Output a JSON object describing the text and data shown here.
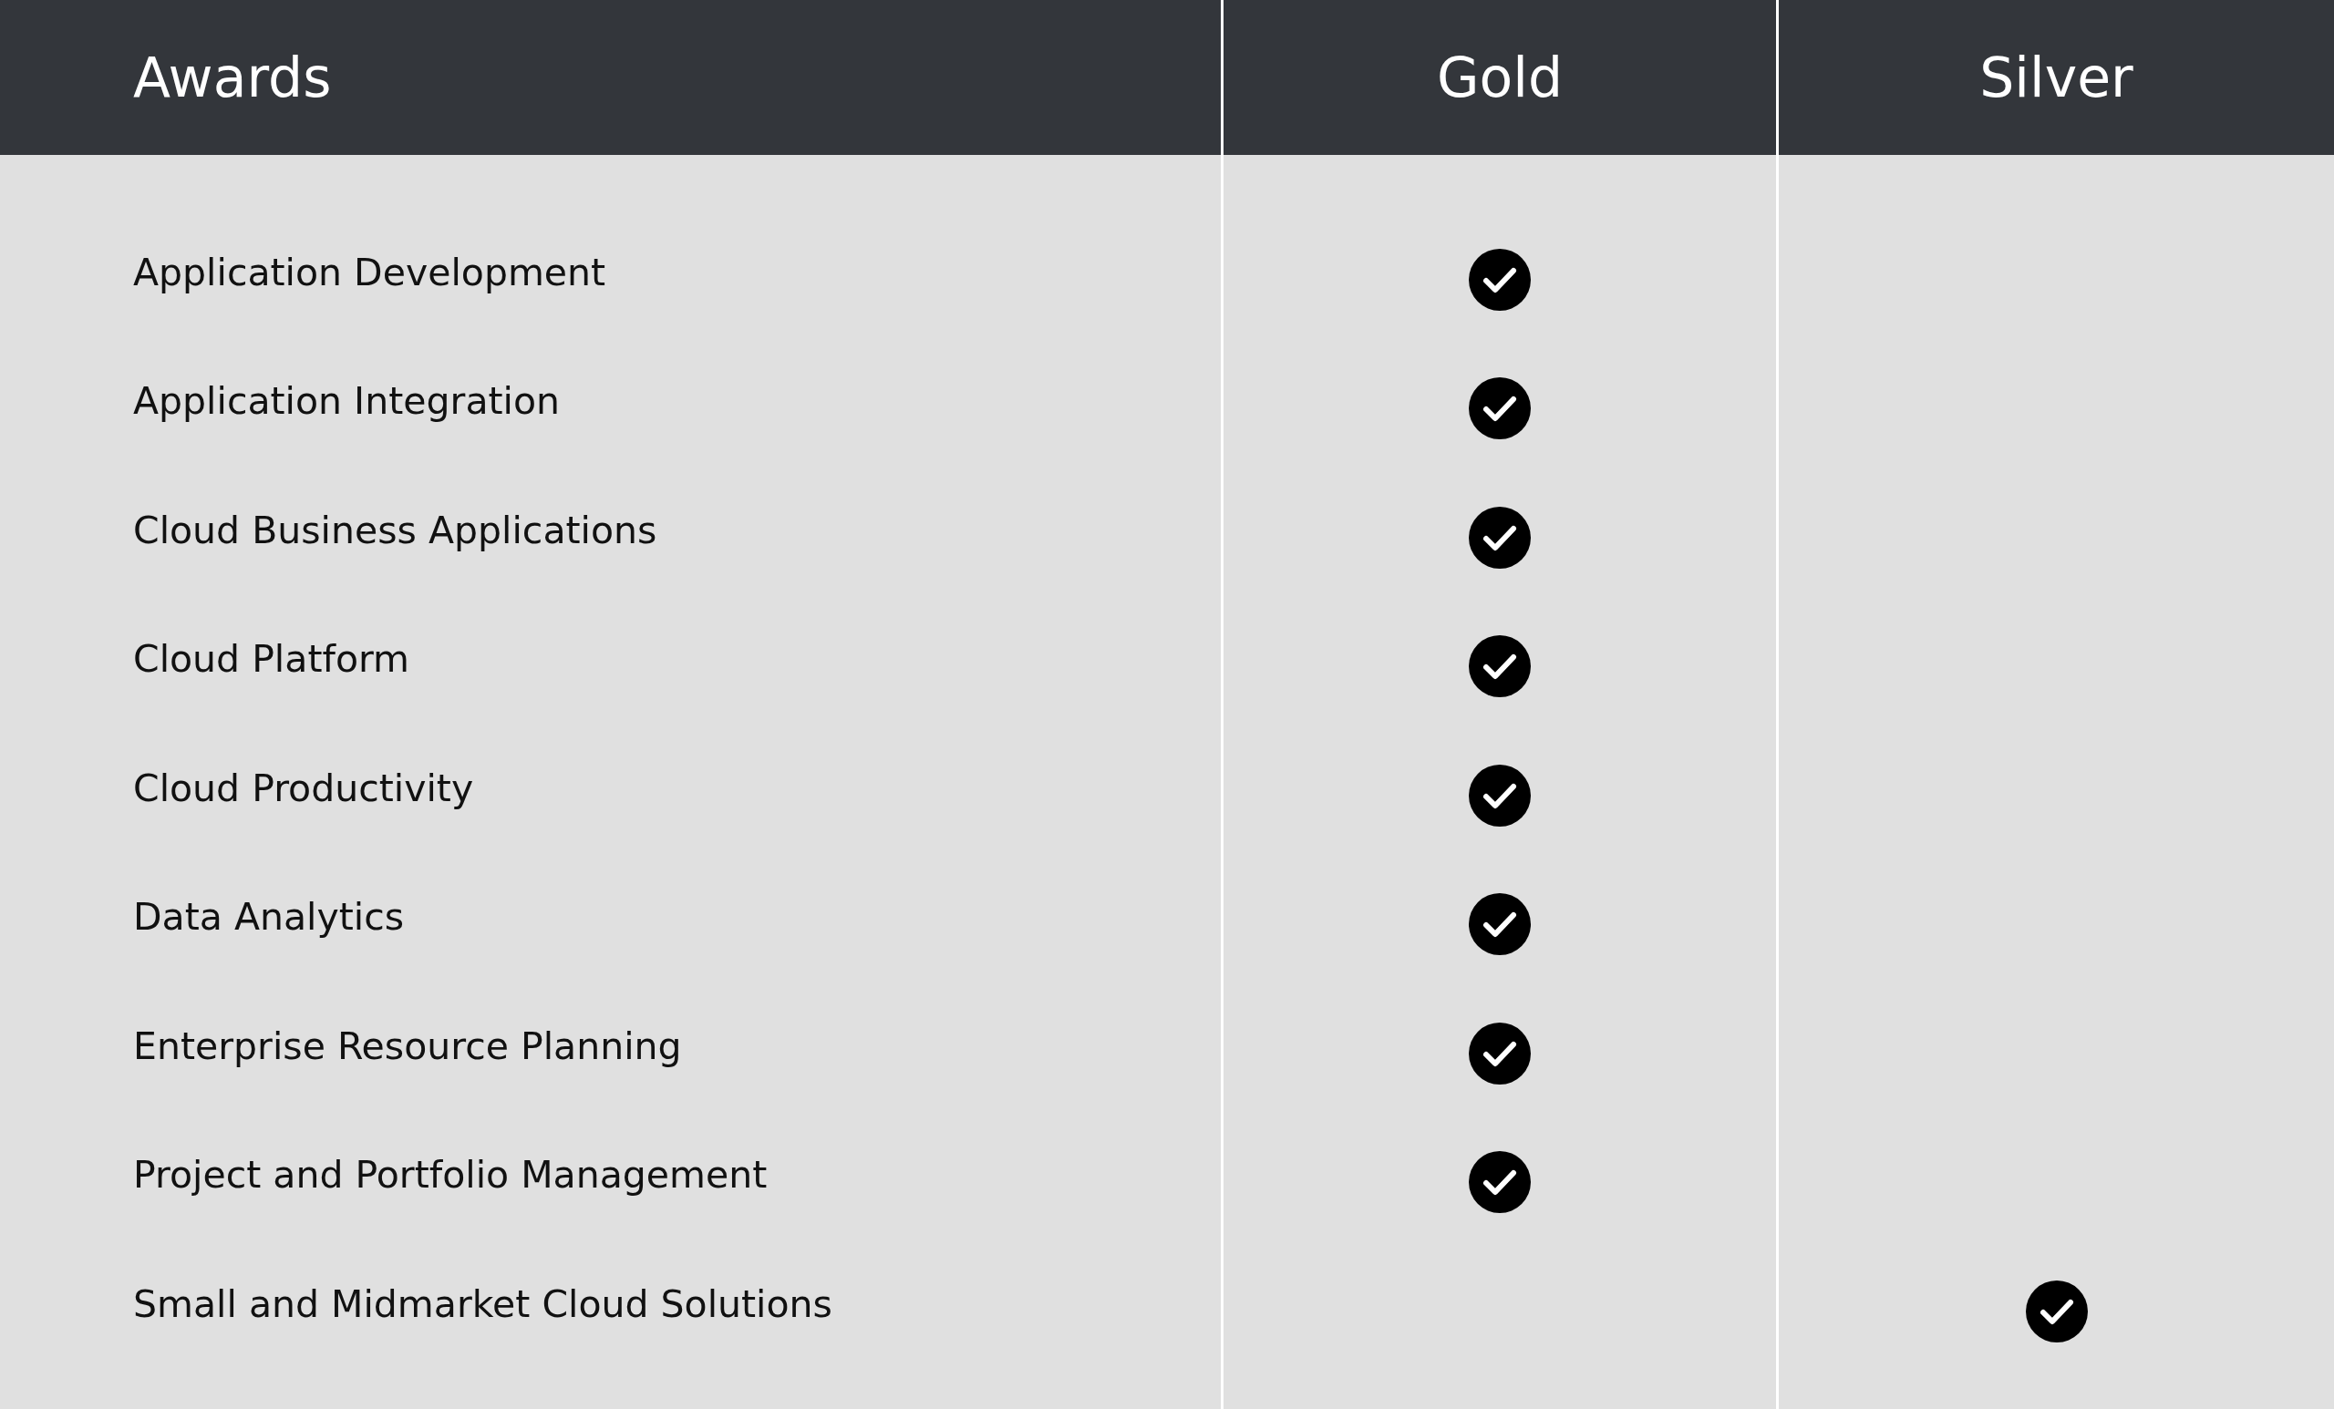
{
  "table": {
    "columns": [
      "Awards",
      "Gold",
      "Silver"
    ],
    "rows": [
      {
        "award": "Application Development",
        "gold": true,
        "silver": false
      },
      {
        "award": "Application Integration",
        "gold": true,
        "silver": false
      },
      {
        "award": "Cloud Business Applications",
        "gold": true,
        "silver": false
      },
      {
        "award": "Cloud Platform",
        "gold": true,
        "silver": false
      },
      {
        "award": "Cloud Productivity",
        "gold": true,
        "silver": false
      },
      {
        "award": "Data Analytics",
        "gold": true,
        "silver": false
      },
      {
        "award": "Enterprise Resource Planning",
        "gold": true,
        "silver": false
      },
      {
        "award": "Project and Portfolio Management",
        "gold": true,
        "silver": false
      },
      {
        "award": "Small and Midmarket Cloud Solutions",
        "gold": false,
        "silver": true
      }
    ]
  }
}
